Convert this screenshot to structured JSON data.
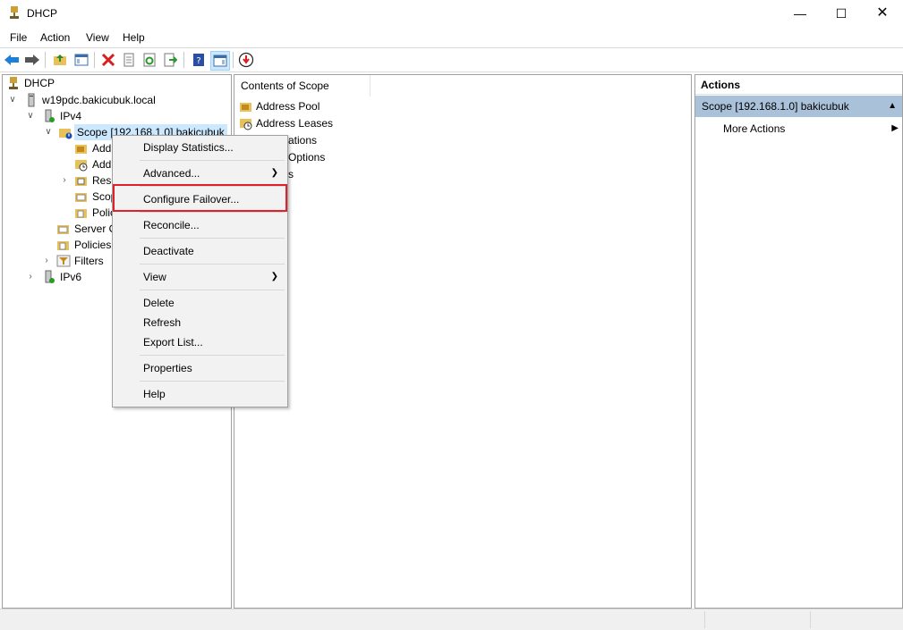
{
  "window": {
    "title": "DHCP"
  },
  "menubar": {
    "items": [
      "File",
      "Action",
      "View",
      "Help"
    ]
  },
  "tree": {
    "root": "DHCP",
    "server": "w19pdc.bakicubuk.local",
    "ipv4": "IPv4",
    "scope": "Scope [192.168.1.0] bakicubuk",
    "scope_children": [
      "Add",
      "Add",
      "Rese",
      "Scop",
      "Polic"
    ],
    "server_options": "Server O",
    "policies": "Policies",
    "filters": "Filters",
    "ipv6": "IPv6"
  },
  "content": {
    "header": "Contents of Scope",
    "rows": [
      "Address Pool",
      "Address Leases",
      "ations",
      "Options",
      "s"
    ]
  },
  "context_menu": {
    "items": [
      {
        "label": "Display Statistics..."
      },
      {
        "label": "Advanced..."
      },
      {
        "label": "Configure Failover..."
      },
      {
        "label": "Reconcile..."
      },
      {
        "label": "Deactivate"
      },
      {
        "label": "View"
      },
      {
        "label": "Delete"
      },
      {
        "label": "Refresh"
      },
      {
        "label": "Export List..."
      },
      {
        "label": "Properties"
      },
      {
        "label": "Help"
      }
    ]
  },
  "actions": {
    "header": "Actions",
    "scope": "Scope [192.168.1.0] bakicubuk",
    "more": "More Actions"
  },
  "colors": {
    "highlight_border": "#e0202a",
    "actions_selected": "#a9c1d9"
  }
}
